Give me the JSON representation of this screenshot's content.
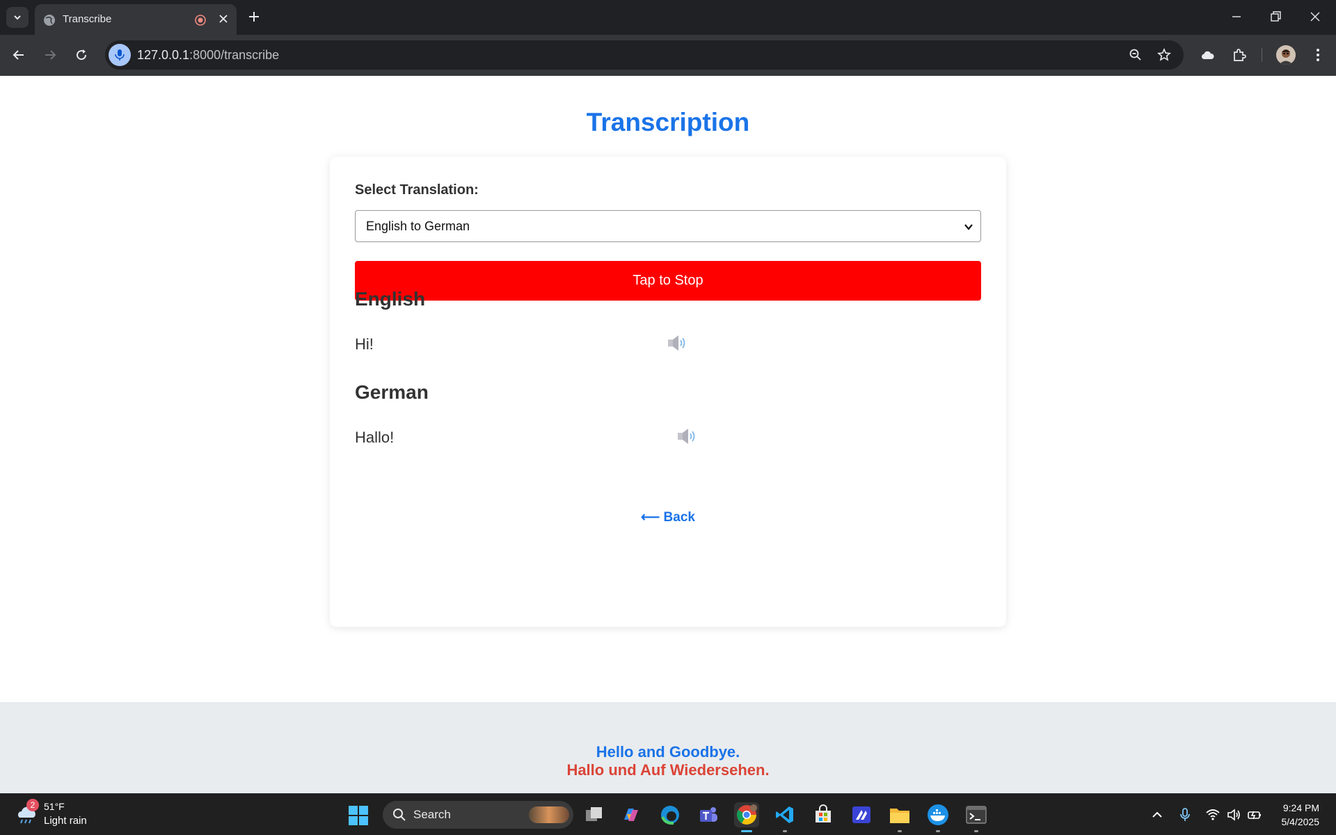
{
  "browser": {
    "tab_title": "Transcribe",
    "url_host": "127.0.0.1",
    "url_rest": ":8000/transcribe"
  },
  "page": {
    "title": "Transcription",
    "select_label": "Select Translation:",
    "select_value": "English to German",
    "record_button": "Tap to Stop",
    "record_color": "#ff0000",
    "source_heading": "English",
    "source_text": "Hi!",
    "target_heading": "German",
    "target_text": "Hallo!",
    "back_label": "⟵ Back",
    "accent": "#1a73e8"
  },
  "footer": {
    "line_en": "Hello and Goodbye.",
    "line_de": "Hallo und Auf Wiedersehen."
  },
  "taskbar": {
    "weather_badge": "2",
    "temperature": "51°F",
    "condition": "Light rain",
    "search_placeholder": "Search",
    "time": "9:24 PM",
    "date": "5/4/2025"
  }
}
